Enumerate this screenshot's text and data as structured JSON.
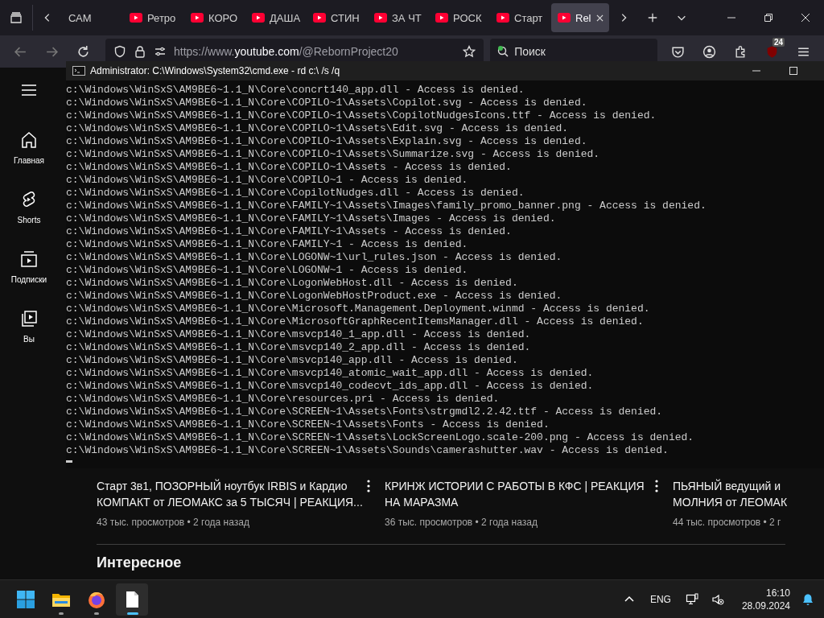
{
  "browser": {
    "tabs": [
      {
        "label": "САМ",
        "selected": false,
        "favicon": false
      },
      {
        "label": "Ретро",
        "selected": false,
        "favicon": true
      },
      {
        "label": "КОРО",
        "selected": false,
        "favicon": true
      },
      {
        "label": "ДАША",
        "selected": false,
        "favicon": true
      },
      {
        "label": "СТИН",
        "selected": false,
        "favicon": true
      },
      {
        "label": "ЗА ЧТ",
        "selected": false,
        "favicon": true
      },
      {
        "label": "РОСК",
        "selected": false,
        "favicon": true
      },
      {
        "label": "Старт",
        "selected": false,
        "favicon": true
      },
      {
        "label": "Rel",
        "selected": true,
        "favicon": true
      }
    ],
    "address": {
      "prefix": "https://www.",
      "host": "youtube.com",
      "path": "/@RebornProject20"
    },
    "search": {
      "placeholder": "Поиск"
    },
    "extension_badge": "24"
  },
  "youtube": {
    "sidebar": [
      {
        "label": "Главная",
        "kind": "home"
      },
      {
        "label": "Shorts",
        "kind": "shorts"
      },
      {
        "label": "Подписки",
        "kind": "subscriptions"
      },
      {
        "label": "Вы",
        "kind": "you"
      }
    ],
    "videos": [
      {
        "title_lines": [
          "Старт 3в1, ПОЗОРНЫЙ ноутбук IRBIS и Кардио",
          "КОМПАКТ от ЛЕОМАКС за 5 ТЫСЯЧ | РЕАКЦИЯ..."
        ],
        "meta": "43 тыс. просмотров • 2 года назад"
      },
      {
        "title_lines": [
          "КРИНЖ ИСТОРИИ С РАБОТЫ В КФС | РЕАКЦИЯ",
          "НА МАРАЗМА"
        ],
        "meta": "36 тыс. просмотров • 2 года назад"
      },
      {
        "title_lines": [
          "ПЬЯНЫЙ ведущий и",
          "МОЛНИЯ от ЛЕОМАК"
        ],
        "meta": "44 тыс. просмотров • 2 г"
      }
    ],
    "section_heading": "Интересное"
  },
  "console": {
    "title": "Administrator: C:\\Windows\\System32\\cmd.exe - rd  c:\\ /s /q",
    "lines": [
      "c:\\Windows\\WinSxS\\AM9BE6~1.1_N\\Core\\concrt140_app.dll - Access is denied.",
      "c:\\Windows\\WinSxS\\AM9BE6~1.1_N\\Core\\COPILO~1\\Assets\\Copilot.svg - Access is denied.",
      "c:\\Windows\\WinSxS\\AM9BE6~1.1_N\\Core\\COPILO~1\\Assets\\CopilotNudgesIcons.ttf - Access is denied.",
      "c:\\Windows\\WinSxS\\AM9BE6~1.1_N\\Core\\COPILO~1\\Assets\\Edit.svg - Access is denied.",
      "c:\\Windows\\WinSxS\\AM9BE6~1.1_N\\Core\\COPILO~1\\Assets\\Explain.svg - Access is denied.",
      "c:\\Windows\\WinSxS\\AM9BE6~1.1_N\\Core\\COPILO~1\\Assets\\Summarize.svg - Access is denied.",
      "c:\\Windows\\WinSxS\\AM9BE6~1.1_N\\Core\\COPILO~1\\Assets - Access is denied.",
      "c:\\Windows\\WinSxS\\AM9BE6~1.1_N\\Core\\COPILO~1 - Access is denied.",
      "c:\\Windows\\WinSxS\\AM9BE6~1.1_N\\Core\\CopilotNudges.dll - Access is denied.",
      "c:\\Windows\\WinSxS\\AM9BE6~1.1_N\\Core\\FAMILY~1\\Assets\\Images\\family_promo_banner.png - Access is denied.",
      "c:\\Windows\\WinSxS\\AM9BE6~1.1_N\\Core\\FAMILY~1\\Assets\\Images - Access is denied.",
      "c:\\Windows\\WinSxS\\AM9BE6~1.1_N\\Core\\FAMILY~1\\Assets - Access is denied.",
      "c:\\Windows\\WinSxS\\AM9BE6~1.1_N\\Core\\FAMILY~1 - Access is denied.",
      "c:\\Windows\\WinSxS\\AM9BE6~1.1_N\\Core\\LOGONW~1\\url_rules.json - Access is denied.",
      "c:\\Windows\\WinSxS\\AM9BE6~1.1_N\\Core\\LOGONW~1 - Access is denied.",
      "c:\\Windows\\WinSxS\\AM9BE6~1.1_N\\Core\\LogonWebHost.dll - Access is denied.",
      "c:\\Windows\\WinSxS\\AM9BE6~1.1_N\\Core\\LogonWebHostProduct.exe - Access is denied.",
      "c:\\Windows\\WinSxS\\AM9BE6~1.1_N\\Core\\Microsoft.Management.Deployment.winmd - Access is denied.",
      "c:\\Windows\\WinSxS\\AM9BE6~1.1_N\\Core\\MicrosoftGraphRecentItemsManager.dll - Access is denied.",
      "c:\\Windows\\WinSxS\\AM9BE6~1.1_N\\Core\\msvcp140_1_app.dll - Access is denied.",
      "c:\\Windows\\WinSxS\\AM9BE6~1.1_N\\Core\\msvcp140_2_app.dll - Access is denied.",
      "c:\\Windows\\WinSxS\\AM9BE6~1.1_N\\Core\\msvcp140_app.dll - Access is denied.",
      "c:\\Windows\\WinSxS\\AM9BE6~1.1_N\\Core\\msvcp140_atomic_wait_app.dll - Access is denied.",
      "c:\\Windows\\WinSxS\\AM9BE6~1.1_N\\Core\\msvcp140_codecvt_ids_app.dll - Access is denied.",
      "c:\\Windows\\WinSxS\\AM9BE6~1.1_N\\Core\\resources.pri - Access is denied.",
      "c:\\Windows\\WinSxS\\AM9BE6~1.1_N\\Core\\SCREEN~1\\Assets\\Fonts\\strgmdl2.2.42.ttf - Access is denied.",
      "c:\\Windows\\WinSxS\\AM9BE6~1.1_N\\Core\\SCREEN~1\\Assets\\Fonts - Access is denied.",
      "c:\\Windows\\WinSxS\\AM9BE6~1.1_N\\Core\\SCREEN~1\\Assets\\LockScreenLogo.scale-200.png - Access is denied.",
      "c:\\Windows\\WinSxS\\AM9BE6~1.1_N\\Core\\SCREEN~1\\Assets\\Sounds\\camerashutter.wav - Access is denied."
    ]
  },
  "taskbar": {
    "apps": [
      {
        "kind": "start",
        "running": false,
        "selected": false
      },
      {
        "kind": "explorer",
        "running": true,
        "selected": false
      },
      {
        "kind": "firefox",
        "running": true,
        "selected": false
      },
      {
        "kind": "notepad",
        "running": true,
        "selected": true
      }
    ],
    "language": "ENG",
    "time": "16:10",
    "date": "28.09.2024"
  }
}
